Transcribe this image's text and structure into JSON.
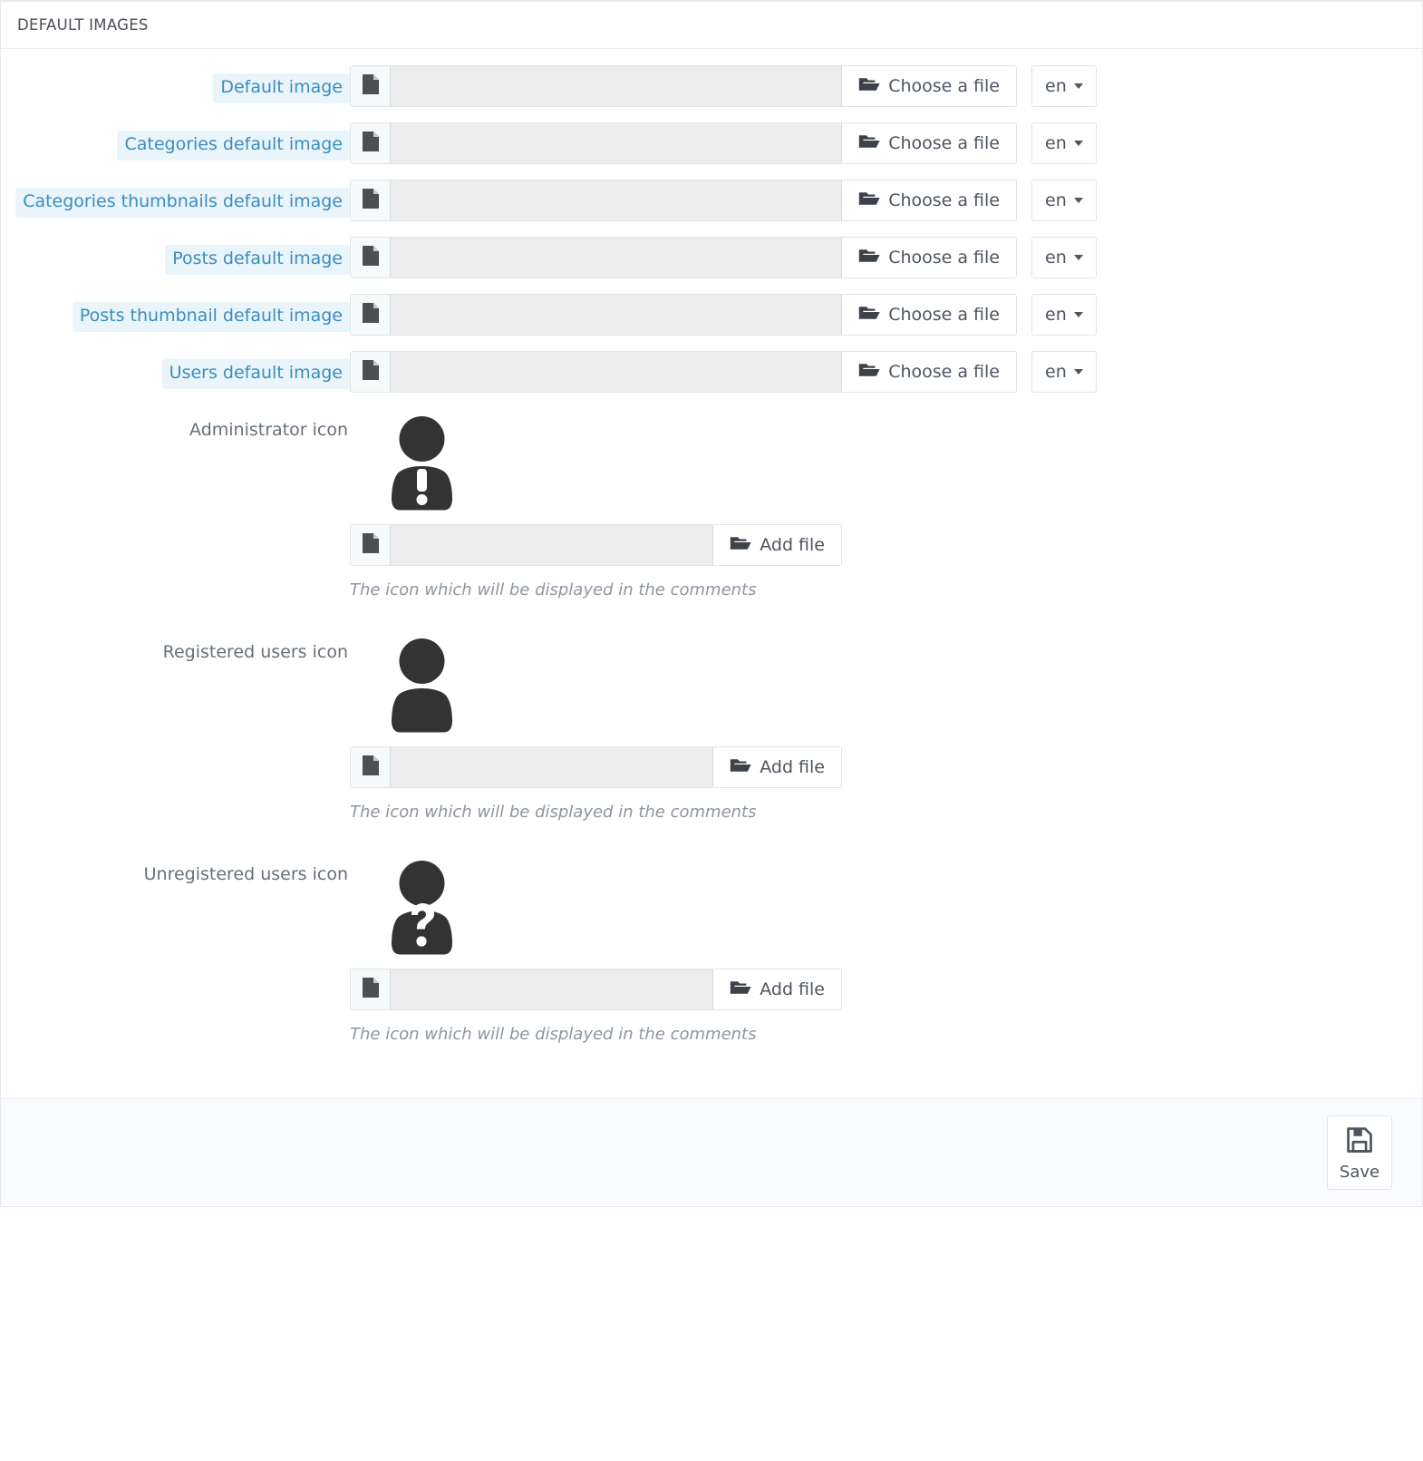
{
  "panel": {
    "title": "DEFAULT IMAGES"
  },
  "file_rows": [
    {
      "label": "Default image",
      "value": "",
      "button": "Choose a file",
      "lang": "en",
      "file_icon": "document-icon",
      "button_icon": "folder-open-icon"
    },
    {
      "label": "Categories default image",
      "value": "",
      "button": "Choose a file",
      "lang": "en",
      "file_icon": "document-icon",
      "button_icon": "folder-open-icon"
    },
    {
      "label": "Categories thumbnails default image",
      "value": "",
      "button": "Choose a file",
      "lang": "en",
      "file_icon": "document-icon",
      "button_icon": "folder-open-icon"
    },
    {
      "label": "Posts default image",
      "value": "",
      "button": "Choose a file",
      "lang": "en",
      "file_icon": "document-icon",
      "button_icon": "folder-open-icon"
    },
    {
      "label": "Posts thumbnail default image",
      "value": "",
      "button": "Choose a file",
      "lang": "en",
      "file_icon": "document-icon",
      "button_icon": "folder-open-icon"
    },
    {
      "label": "Users default image",
      "value": "",
      "button": "Choose a file",
      "lang": "en",
      "file_icon": "document-icon",
      "button_icon": "folder-open-icon"
    }
  ],
  "icon_rows": [
    {
      "label": "Administrator icon",
      "avatar": "user-exclamation-icon",
      "value": "",
      "button": "Add file",
      "helper": "The icon which will be displayed in the comments",
      "file_icon": "document-icon",
      "button_icon": "folder-open-icon"
    },
    {
      "label": "Registered users icon",
      "avatar": "user-icon",
      "value": "",
      "button": "Add file",
      "helper": "The icon which will be displayed in the comments",
      "file_icon": "document-icon",
      "button_icon": "folder-open-icon"
    },
    {
      "label": "Unregistered users icon",
      "avatar": "user-question-icon",
      "value": "",
      "button": "Add file",
      "helper": "The icon which will be displayed in the comments",
      "file_icon": "document-icon",
      "button_icon": "folder-open-icon"
    }
  ],
  "footer": {
    "save_label": "Save",
    "save_icon": "floppy-disk-icon"
  },
  "colors": {
    "label_bg": "#e9f4fb",
    "label_text": "#3c8dbc",
    "input_field_bg": "#ededed",
    "avatar_dark": "#333333",
    "footer_bg": "#fafbfe"
  }
}
